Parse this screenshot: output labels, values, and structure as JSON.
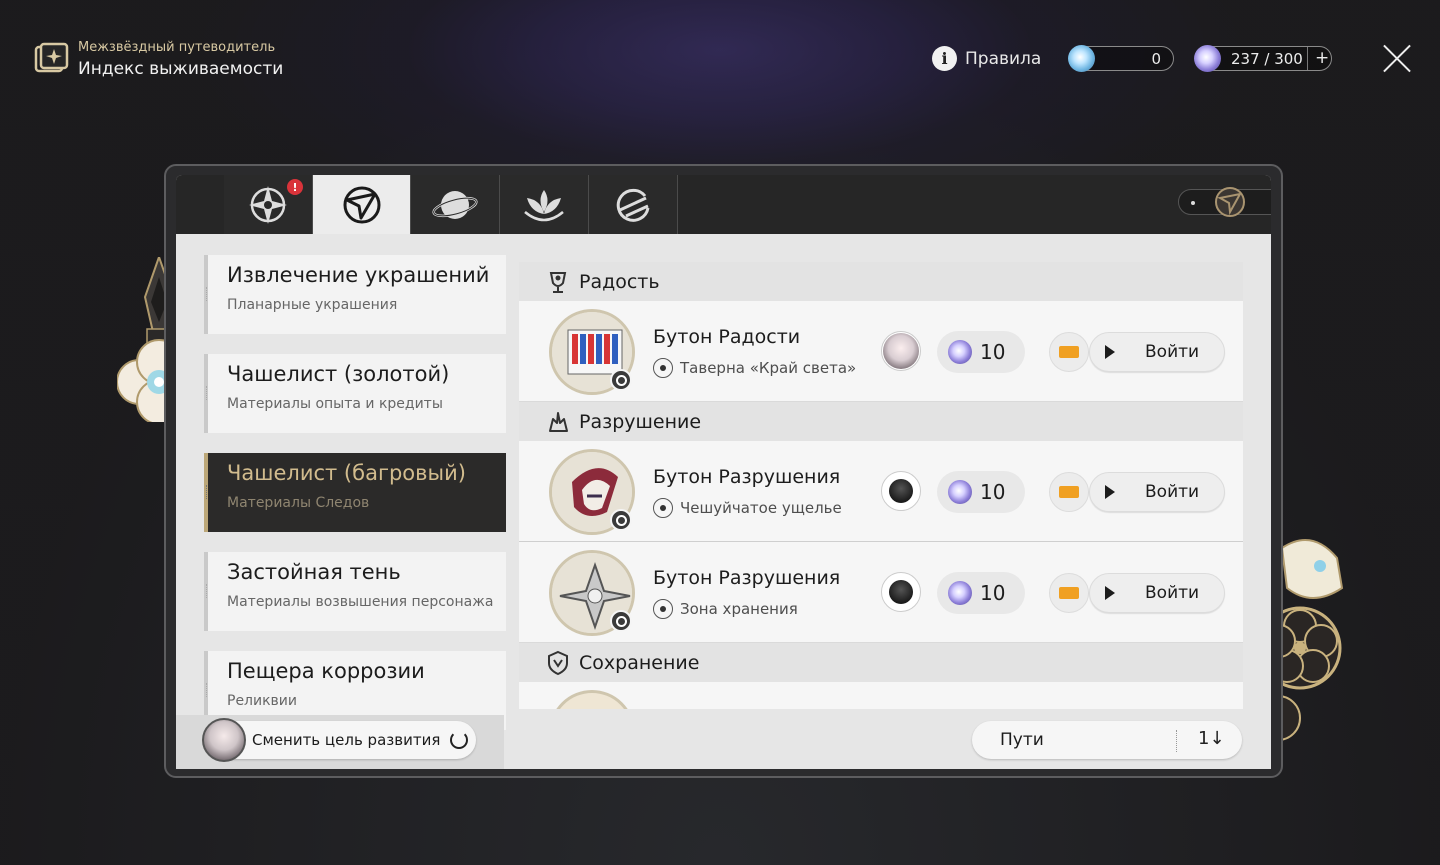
{
  "header": {
    "subtitle": "Межзвёздный путеводитель",
    "title": "Индекс выживаемости",
    "rules_label": "Правила",
    "fuel_count": "0",
    "power_label": "237 / 300",
    "add_symbol": "+"
  },
  "tabs": [
    {
      "icon": "compass-star-icon",
      "alert": "!"
    },
    {
      "icon": "trailblaze-shield-icon"
    },
    {
      "icon": "planet-icon"
    },
    {
      "icon": "lotus-icon"
    },
    {
      "icon": "cycle-icon"
    }
  ],
  "categories": [
    {
      "title": "Извлечение украшений",
      "subtitle": "Планарные украшения"
    },
    {
      "title": "Чашелист (золотой)",
      "subtitle": "Материалы опыта и кредиты"
    },
    {
      "title": "Чашелист (багровый)",
      "subtitle": "Материалы Следов",
      "selected": true
    },
    {
      "title": "Застойная тень",
      "subtitle": "Материалы возвышения персонажа"
    },
    {
      "title": "Пещера коррозии",
      "subtitle": "Реликвии"
    }
  ],
  "sections": [
    {
      "title": "Радость",
      "rows": [
        {
          "name": "Бутон Радости",
          "location": "Таверна «Край света»",
          "cost": "10",
          "enter": "Войти"
        }
      ]
    },
    {
      "title": "Разрушение",
      "rows": [
        {
          "name": "Бутон Разрушения",
          "location": "Чешуйчатое ущелье",
          "cost": "10",
          "enter": "Войти"
        },
        {
          "name": "Бутон Разрушения",
          "location": "Зона хранения",
          "cost": "10",
          "enter": "Войти"
        }
      ]
    },
    {
      "title": "Сохранение",
      "rows": []
    }
  ],
  "footer": {
    "change_goal": "Сменить цель развития",
    "sort_label": "Пути",
    "sort_order_symbol": "1↓"
  },
  "colors": {
    "accent_gold": "#bca778",
    "ticket_orange": "#f0a022",
    "alert_red": "#d9333a"
  }
}
